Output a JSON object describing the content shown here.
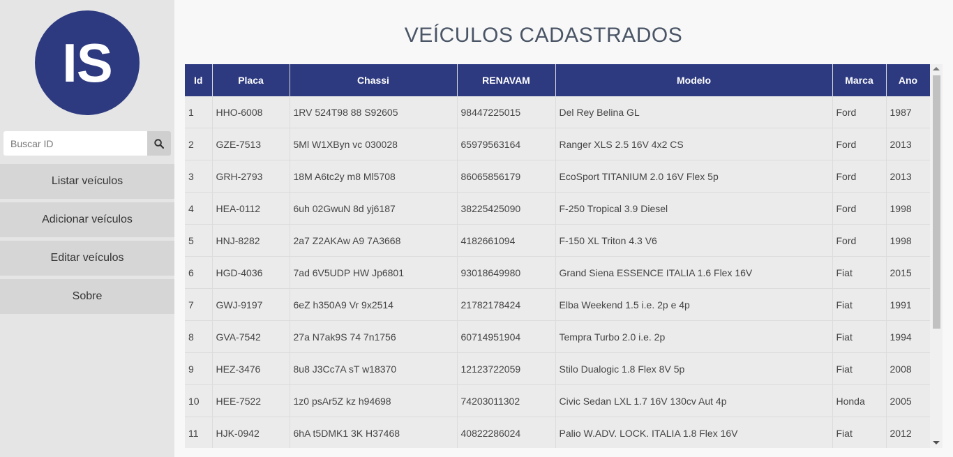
{
  "sidebar": {
    "logo_text": "IS",
    "search": {
      "placeholder": "Buscar ID",
      "value": ""
    },
    "nav": [
      {
        "label": "Listar veículos"
      },
      {
        "label": "Adicionar veículos"
      },
      {
        "label": "Editar veículos"
      },
      {
        "label": "Sobre"
      }
    ]
  },
  "main": {
    "title": "VEÍCULOS CADASTRADOS",
    "table": {
      "headers": [
        "Id",
        "Placa",
        "Chassi",
        "RENAVAM",
        "Modelo",
        "Marca",
        "Ano"
      ],
      "rows": [
        [
          "1",
          "HHO-6008",
          "1RV 524T98 88 S92605",
          "98447225015",
          "Del Rey Belina GL",
          "Ford",
          "1987"
        ],
        [
          "2",
          "GZE-7513",
          "5Ml W1XByn vc 030028",
          "65979563164",
          "Ranger XLS 2.5 16V 4x2 CS",
          "Ford",
          "2013"
        ],
        [
          "3",
          "GRH-2793",
          "18M A6tc2y m8 Ml5708",
          "86065856179",
          "EcoSport TITANIUM 2.0 16V Flex 5p",
          "Ford",
          "2013"
        ],
        [
          "4",
          "HEA-0112",
          "6uh 02GwuN 8d yj6187",
          "38225425090",
          "F-250 Tropical 3.9 Diesel",
          "Ford",
          "1998"
        ],
        [
          "5",
          "HNJ-8282",
          "2a7 Z2AKAw A9 7A3668",
          "4182661094",
          "F-150 XL Triton 4.3 V6",
          "Ford",
          "1998"
        ],
        [
          "6",
          "HGD-4036",
          "7ad 6V5UDP HW Jp6801",
          "93018649980",
          "Grand Siena ESSENCE ITALIA 1.6 Flex 16V",
          "Fiat",
          "2015"
        ],
        [
          "7",
          "GWJ-9197",
          "6eZ h350A9 Vr 9x2514",
          "21782178424",
          "Elba Weekend 1.5 i.e. 2p e 4p",
          "Fiat",
          "1991"
        ],
        [
          "8",
          "GVA-7542",
          "27a N7ak9S 74 7n1756",
          "60714951904",
          "Tempra Turbo 2.0 i.e. 2p",
          "Fiat",
          "1994"
        ],
        [
          "9",
          "HEZ-3476",
          "8u8 J3Cc7A sT w18370",
          "12123722059",
          "Stilo Dualogic 1.8 Flex 8V 5p",
          "Fiat",
          "2008"
        ],
        [
          "10",
          "HEE-7522",
          "1z0 psAr5Z kz h94698",
          "74203011302",
          "Civic Sedan LXL 1.7 16V 130cv Aut 4p",
          "Honda",
          "2005"
        ],
        [
          "11",
          "HJK-0942",
          "6hA t5DMK1 3K H37468",
          "40822286024",
          "Palio W.ADV. LOCK. ITALIA 1.8 Flex 16V",
          "Fiat",
          "2012"
        ]
      ]
    }
  },
  "colors": {
    "accent": "#2d3a80",
    "sidebar_bg": "#e5e5e5",
    "nav_bg": "#d6d6d6"
  },
  "icons": {
    "search": "search-icon"
  }
}
